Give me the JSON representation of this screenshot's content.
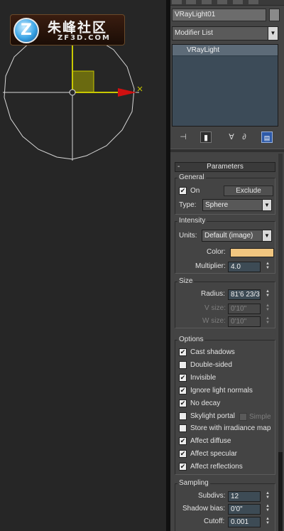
{
  "logo": {
    "mark": "Z",
    "title_cn": "朱峰社区",
    "title_en": "ZF3D.COM"
  },
  "panel": {
    "object_name": "VRayLight01",
    "modifier_list": "Modifier List",
    "stack_item": "VRayLight",
    "tool_icons": [
      "pin-stack-icon",
      "show-end-result-icon",
      "make-unique-icon",
      "remove-modifier-icon",
      "configure-modifier-sets-icon"
    ]
  },
  "parameters": {
    "title": "Parameters",
    "general": {
      "title": "General",
      "on_label": "On",
      "on_checked": true,
      "exclude_label": "Exclude",
      "type_label": "Type:",
      "type_value": "Sphere"
    },
    "intensity": {
      "title": "Intensity",
      "units_label": "Units:",
      "units_value": "Default (image)",
      "color_label": "Color:",
      "color_value": "#f1c680",
      "multiplier_label": "Multiplier:",
      "multiplier_value": "4.0"
    },
    "size": {
      "title": "Size",
      "radius_label": "Radius:",
      "radius_value": "81'6 23/3",
      "vsize_label": "V size:",
      "vsize_value": "0'10\"",
      "wsize_label": "W size:",
      "wsize_value": "0'10\""
    },
    "options": {
      "title": "Options",
      "items": [
        {
          "label": "Cast shadows",
          "checked": true
        },
        {
          "label": "Double-sided",
          "checked": false
        },
        {
          "label": "Invisible",
          "checked": true
        },
        {
          "label": "Ignore light normals",
          "checked": true
        },
        {
          "label": "No decay",
          "checked": true
        },
        {
          "label": "Skylight portal",
          "checked": false
        },
        {
          "label": "Store with irradiance map",
          "checked": false
        },
        {
          "label": "Affect diffuse",
          "checked": true
        },
        {
          "label": "Affect specular",
          "checked": true
        },
        {
          "label": "Affect reflections",
          "checked": true
        }
      ],
      "simple_label": "Simple"
    },
    "sampling": {
      "title": "Sampling",
      "subdivs_label": "Subdivs:",
      "subdivs_value": "12",
      "shadow_bias_label": "Shadow bias:",
      "shadow_bias_value": "0'0\"",
      "cutoff_label": "Cutoff:",
      "cutoff_value": "0.001"
    }
  },
  "colors": {
    "accent_light_color": "#f1c680",
    "gizmo_yellow": "#c8c800",
    "axis_red": "#d01010"
  }
}
